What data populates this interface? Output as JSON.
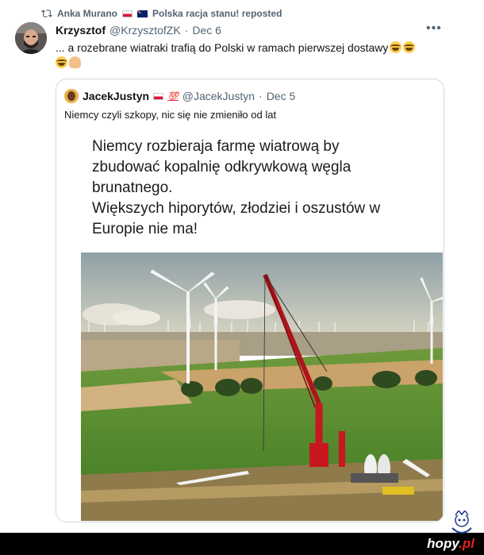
{
  "repost": {
    "reposter": "Anka Murano",
    "flags": [
      "Poland flag",
      "Australia flag"
    ],
    "label": "Polska racja stanu! reposted"
  },
  "post": {
    "author_name": "Krzysztof",
    "author_handle": "@KrzysztofZK",
    "separator": "·",
    "date": "Dec 6",
    "text": "... a rozebrane wiatraki trafią do Polski w ramach pierwszej dostawy",
    "emojis": [
      "face-with-tears-of-joy",
      "face-with-tears-of-joy",
      "face-with-tears-of-joy",
      "person-facepalming"
    ]
  },
  "quoted": {
    "author_name": "JacekJustyn",
    "badge": "💯",
    "author_handle": "@JacekJustyn",
    "separator": "·",
    "date": "Dec 5",
    "text": "Niemcy czyli szkopy, nic się nie zmieniło od lat",
    "image": {
      "caption_lines": [
        "Niemcy rozbieraja farmę wiatrową by",
        "zbudować kopalnię odkrywkową węgla",
        "brunatnego.",
        "Większych hiporytów, złodziei i oszustów w",
        "Europie nie ma!"
      ],
      "description_icon": "wind-farm-photo"
    }
  },
  "watermark": {
    "site": "hopy",
    "tld": ".pl"
  },
  "colors": {
    "text": "#0f1419",
    "secondary": "#536471",
    "border": "#cfd9de",
    "crane_red": "#c8171e"
  }
}
